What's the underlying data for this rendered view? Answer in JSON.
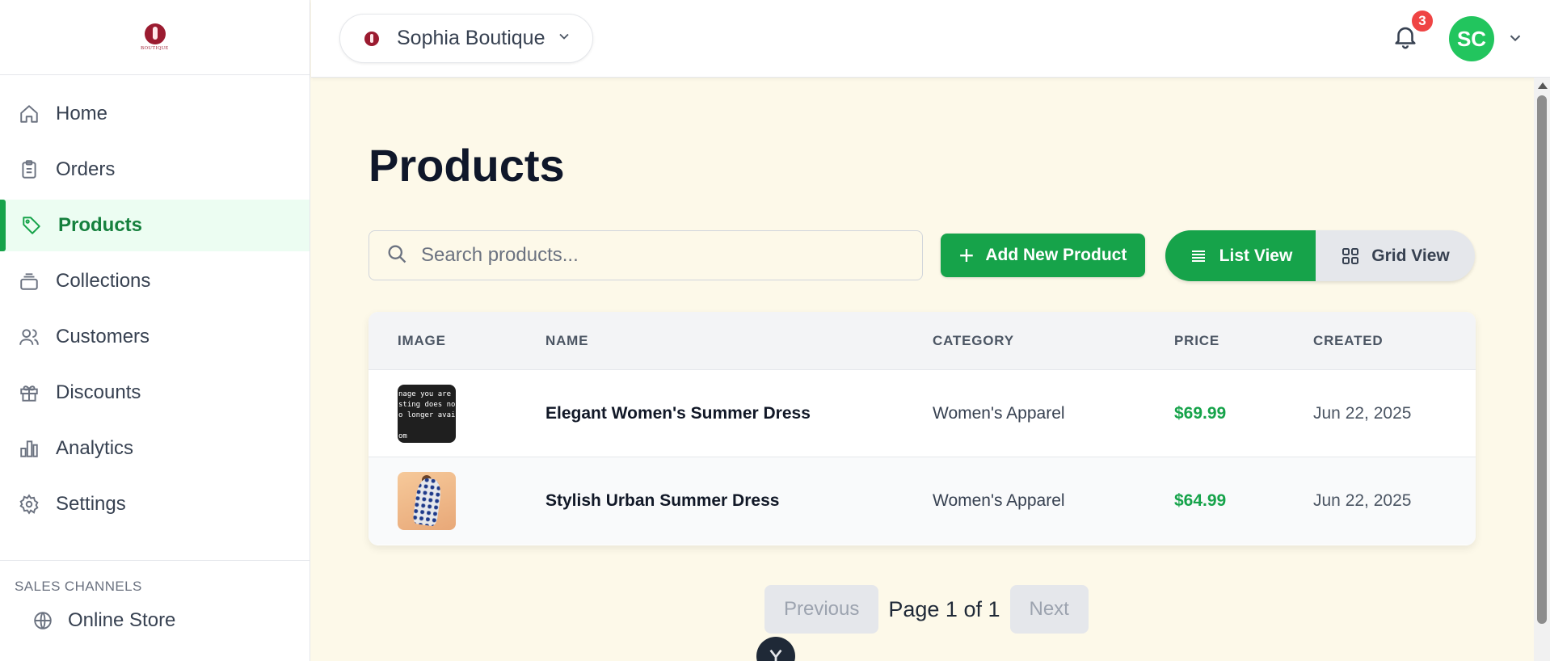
{
  "brand": {
    "logo_text": "BOUTIQUE"
  },
  "sidebar": {
    "items": [
      {
        "label": "Home",
        "icon": "home-icon"
      },
      {
        "label": "Orders",
        "icon": "clipboard-icon"
      },
      {
        "label": "Products",
        "icon": "tag-icon",
        "active": true
      },
      {
        "label": "Collections",
        "icon": "stack-icon"
      },
      {
        "label": "Customers",
        "icon": "users-icon"
      },
      {
        "label": "Discounts",
        "icon": "gift-icon"
      },
      {
        "label": "Analytics",
        "icon": "bar-chart-icon"
      },
      {
        "label": "Settings",
        "icon": "gear-icon"
      }
    ],
    "sales_channels": {
      "title": "SALES CHANNELS",
      "items": [
        {
          "label": "Online Store",
          "icon": "globe-icon"
        }
      ]
    }
  },
  "header": {
    "store_name": "Sophia Boutique",
    "notifications_count": "3",
    "user_initials": "SC"
  },
  "main": {
    "title": "Products",
    "search_placeholder": "Search products...",
    "add_button": "Add New Product",
    "view_list": "List View",
    "view_grid": "Grid View",
    "table": {
      "headers": [
        "IMAGE",
        "NAME",
        "CATEGORY",
        "PRICE",
        "CREATED"
      ],
      "rows": [
        {
          "name": "Elegant Women's Summer Dress",
          "category": "Women's Apparel",
          "price": "$69.99",
          "created": "Jun 22, 2025",
          "image_text": [
            "nage you are",
            "sting does no",
            "o longer avail",
            "",
            "om"
          ]
        },
        {
          "name": "Stylish Urban Summer Dress",
          "category": "Women's Apparel",
          "price": "$64.99",
          "created": "Jun 22, 2025"
        }
      ]
    },
    "pagination": {
      "previous": "Previous",
      "info": "Page 1 of 1",
      "next": "Next"
    }
  },
  "colors": {
    "accent": "#16a34a",
    "background": "#fdf9e9",
    "badge": "#ef4444",
    "brand": "#9b1b30"
  }
}
